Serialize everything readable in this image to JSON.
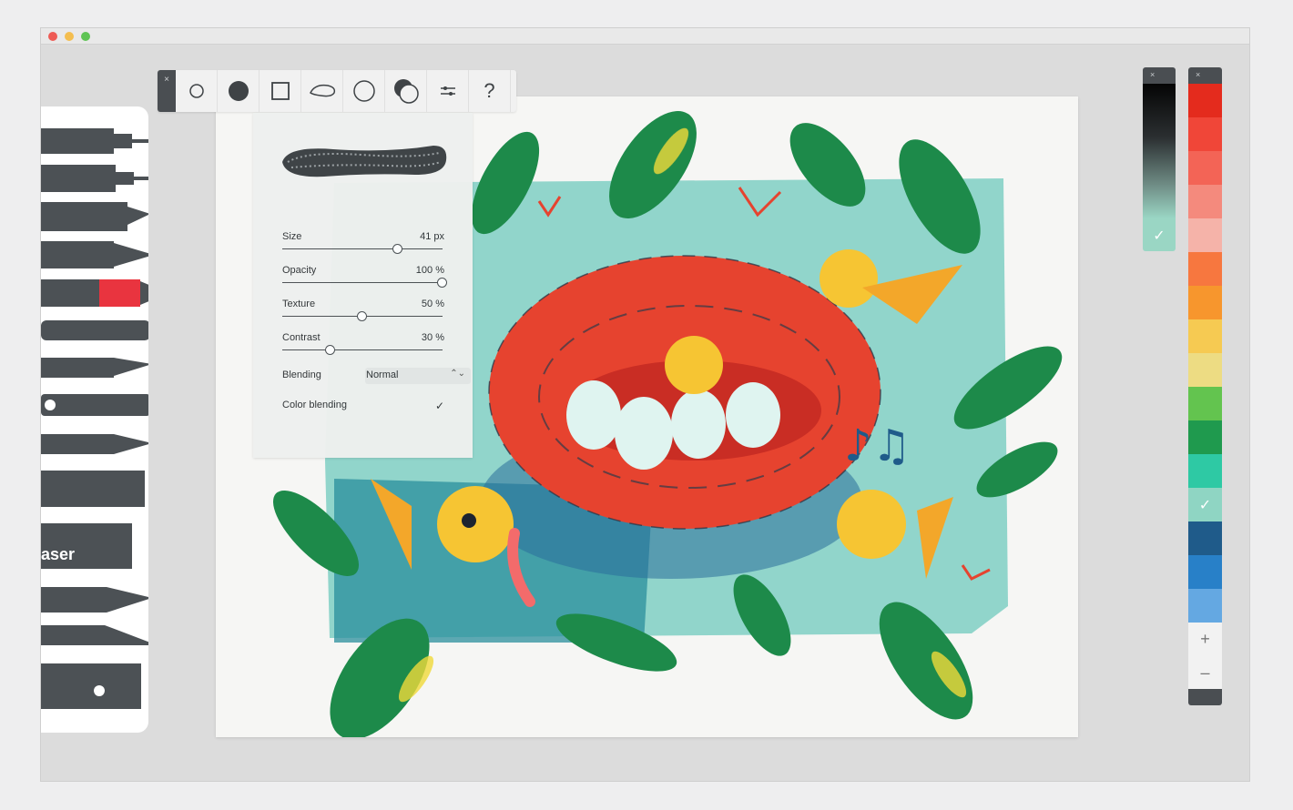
{
  "window": {
    "traffic_lights": [
      "#ee5b55",
      "#f4be4f",
      "#5fc454"
    ]
  },
  "toolbar": {
    "close_label": "×",
    "tools": [
      "small-circle-brush",
      "filled-circle-brush",
      "rectangle-shape",
      "lasso-shape",
      "circle-shape",
      "color-blend-tool",
      "sliders-icon"
    ],
    "help_label": "?"
  },
  "brush_panel": {
    "size": {
      "label": "Size",
      "value": "41 px",
      "level": 0.72
    },
    "opacity": {
      "label": "Opacity",
      "value": "100 %",
      "level": 1.0
    },
    "texture": {
      "label": "Texture",
      "value": "50 %",
      "level": 0.5
    },
    "contrast": {
      "label": "Contrast",
      "value": "30 %",
      "level": 0.3
    },
    "blending": {
      "label": "Blending",
      "value": "Normal"
    },
    "color_blending": {
      "label": "Color blending",
      "checked": true
    }
  },
  "tools_sidebar": {
    "eraser_label": "aser",
    "tools": [
      "fineliner",
      "technical-pen",
      "marker",
      "brush-pen",
      "red-marker",
      "round-brush",
      "flat-brush",
      "ink-pen",
      "fountain-pen",
      "texture-stamp",
      "eraser",
      "chisel-pencil",
      "x-acto-knife",
      "ruler"
    ],
    "accent_color": "#e9343f"
  },
  "grey_palette": {
    "close_label": "×",
    "selected": "#9ad6c4"
  },
  "color_palette": {
    "close_label": "×",
    "swatches": [
      "#e42b1d",
      "#f04638",
      "#f36456",
      "#f48a7d",
      "#f5b3a9",
      "#f7773f",
      "#f7962d",
      "#f6ca52",
      "#eddc83",
      "#63c44f",
      "#1f9a4e",
      "#2ec9a4",
      "#8fd5c3",
      "#1f5b8a",
      "#2880c8",
      "#64a8e2"
    ],
    "selected_index": 12,
    "plus_label": "+",
    "minus_label": "–"
  }
}
